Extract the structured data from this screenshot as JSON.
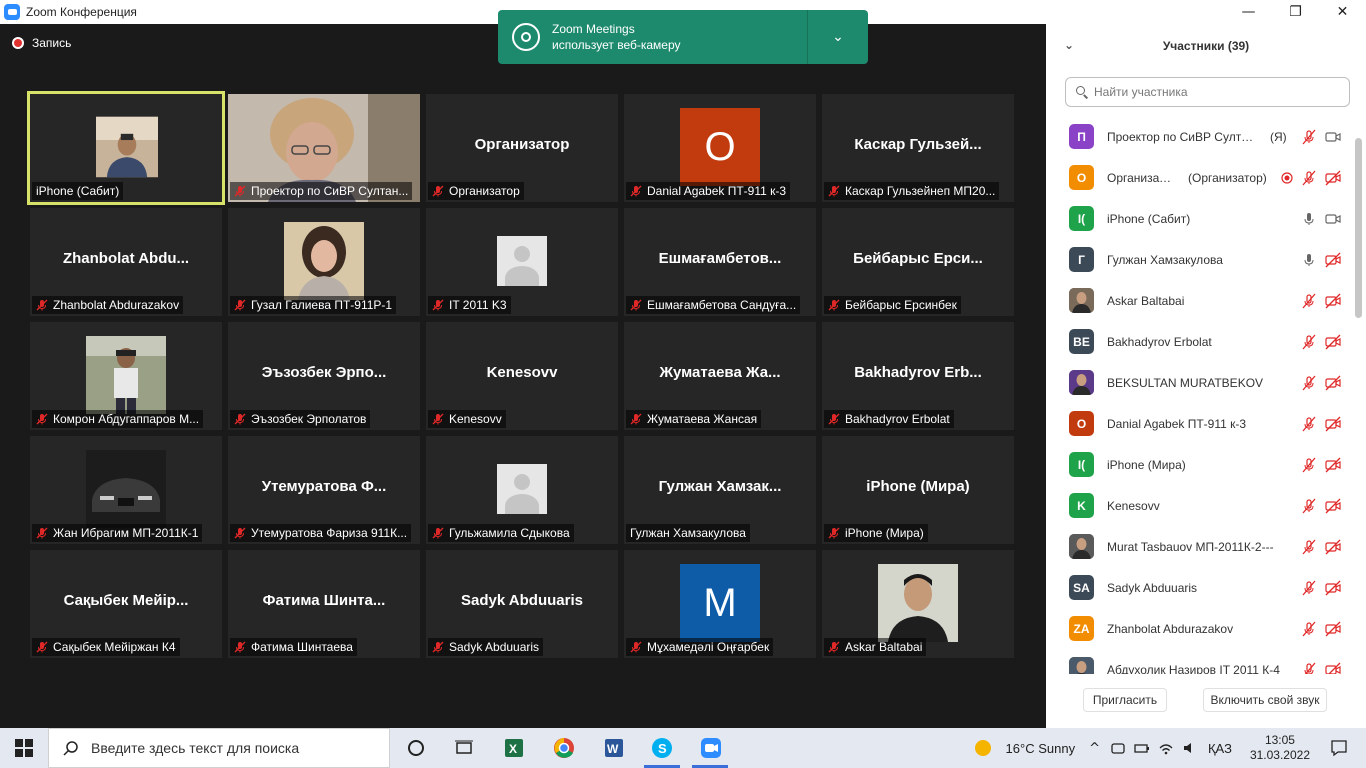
{
  "window": {
    "title": "Zoom Конференция",
    "minimize": "—",
    "restore": "❐",
    "close": "✕"
  },
  "recording": {
    "label": "Запись"
  },
  "notification": {
    "line1": "Zoom Meetings",
    "line2": "использует веб-камеру"
  },
  "tiles": [
    {
      "big": "",
      "label": "iPhone (Сабит)",
      "muted": false,
      "kind": "photo",
      "photo": "man-office"
    },
    {
      "big": "",
      "label": "Проектор по СиВР Султан...",
      "muted": true,
      "kind": "photo",
      "photo": "woman-glasses"
    },
    {
      "big": "Организатор",
      "label": "Организатор",
      "muted": true,
      "kind": "text"
    },
    {
      "big": "",
      "label": "Danial Agabek ПТ-911 к-3",
      "muted": true,
      "kind": "avatar",
      "letter": "O",
      "color": "#c23b0f"
    },
    {
      "big": "Каскар  Гульзей...",
      "label": "Каскар Гульзейнеп МП20...",
      "muted": true,
      "kind": "text"
    },
    {
      "big": "Zhanbolat  Abdu...",
      "label": "Zhanbolat Abdurazakov",
      "muted": true,
      "kind": "text"
    },
    {
      "big": "",
      "label": "Гузал Галиева ПТ-911Р-1",
      "muted": true,
      "kind": "photo",
      "photo": "girl"
    },
    {
      "big": "",
      "label": "IT 2011 K3",
      "muted": true,
      "kind": "placeholder"
    },
    {
      "big": "Ешмағамбетов...",
      "label": "Ешмағамбетова Сандуға...",
      "muted": true,
      "kind": "text"
    },
    {
      "big": "Бейбарыс  Ерси...",
      "label": "Бейбарыс Ерсинбек",
      "muted": true,
      "kind": "text"
    },
    {
      "big": "",
      "label": "Комрон Абдугаппаров М...",
      "muted": true,
      "kind": "photo",
      "photo": "boy-street"
    },
    {
      "big": "Эъзозбек  Эрпо...",
      "label": "Эъзозбек Эрполатов",
      "muted": true,
      "kind": "text"
    },
    {
      "big": "Kenesovv",
      "label": "Kenesovv",
      "muted": true,
      "kind": "text"
    },
    {
      "big": "Жуматаева  Жа...",
      "label": "Жуматаева Жансая",
      "muted": true,
      "kind": "text"
    },
    {
      "big": "Bakhadyrov  Erb...",
      "label": "Bakhadyrov Erbolat",
      "muted": true,
      "kind": "text"
    },
    {
      "big": "",
      "label": "Жан Ибрагим МП-2011К-1",
      "muted": true,
      "kind": "photo",
      "photo": "car"
    },
    {
      "big": "Утемуратова  Ф...",
      "label": "Утемуратова Фариза 911К...",
      "muted": true,
      "kind": "text"
    },
    {
      "big": "",
      "label": "Гульжамила Сдыкова",
      "muted": true,
      "kind": "placeholder"
    },
    {
      "big": "Гулжан  Хамзак...",
      "label": "Гулжан Хамзакулова",
      "muted": false,
      "kind": "text"
    },
    {
      "big": "iPhone (Мира)",
      "label": "iPhone (Мира)",
      "muted": true,
      "kind": "text"
    },
    {
      "big": "Сақыбек  Мейір...",
      "label": "Сақыбек Мейіржан К4",
      "muted": true,
      "kind": "text"
    },
    {
      "big": "Фатима  Шинта...",
      "label": "Фатима Шинтаева",
      "muted": true,
      "kind": "text"
    },
    {
      "big": "Sadyk Abduuaris",
      "label": "Sadyk Abduuaris",
      "muted": true,
      "kind": "text"
    },
    {
      "big": "",
      "label": "Мұхамедәлі Оңғарбек",
      "muted": true,
      "kind": "avatar",
      "letter": "M",
      "color": "#0e5ca8"
    },
    {
      "big": "",
      "label": "Askar Baltabai",
      "muted": true,
      "kind": "photo",
      "photo": "man-young"
    }
  ],
  "panel": {
    "title": "Участники (39)",
    "collapse": "⌄",
    "search_placeholder": "Найти участника",
    "participants": [
      {
        "avatar": "П",
        "color": "#8a43c6",
        "name": "Проектор по СиВР Султан...",
        "role": "(Я)",
        "mic": "muted",
        "video": "on"
      },
      {
        "avatar": "O",
        "color": "#f28c00",
        "name": "Организат...",
        "role": "(Организатор)",
        "mic": "muted",
        "video": "off",
        "recording": true
      },
      {
        "avatar": "I(",
        "color": "#1fa34a",
        "name": "iPhone (Сабит)",
        "role": "",
        "mic": "on",
        "video": "on"
      },
      {
        "avatar": "Г",
        "color": "#3c4a57",
        "name": "Гулжан Хамзакулова",
        "role": "",
        "mic": "on",
        "video": "off"
      },
      {
        "avatar": "",
        "color": "#7a6a5a",
        "name": "Askar Baltabai",
        "role": "",
        "mic": "muted",
        "video": "off",
        "photo": true
      },
      {
        "avatar": "BE",
        "color": "#3c4a57",
        "name": "Bakhadyrov Erbolat",
        "role": "",
        "mic": "muted",
        "video": "off"
      },
      {
        "avatar": "",
        "color": "#5b3a8a",
        "name": "BEKSULTAN MURATBEKOV",
        "role": "",
        "mic": "muted",
        "video": "off",
        "photo": true
      },
      {
        "avatar": "O",
        "color": "#c23b0f",
        "name": "Danial Agabek ПТ-911 к-3",
        "role": "",
        "mic": "muted",
        "video": "off"
      },
      {
        "avatar": "I(",
        "color": "#1fa34a",
        "name": "iPhone (Мира)",
        "role": "",
        "mic": "muted",
        "video": "off"
      },
      {
        "avatar": "K",
        "color": "#1fa34a",
        "name": "Kenesovv",
        "role": "",
        "mic": "muted",
        "video": "off"
      },
      {
        "avatar": "",
        "color": "#5a5a5a",
        "name": "Murat Tasbauov МП-2011К-2---",
        "role": "",
        "mic": "muted",
        "video": "off",
        "photo": true
      },
      {
        "avatar": "SA",
        "color": "#3c4a57",
        "name": "Sadyk Abduuaris",
        "role": "",
        "mic": "muted",
        "video": "off"
      },
      {
        "avatar": "ZA",
        "color": "#f28c00",
        "name": "Zhanbolat Abdurazakov",
        "role": "",
        "mic": "muted",
        "video": "off"
      },
      {
        "avatar": "",
        "color": "#4a5a6a",
        "name": "Абдухолиқ Назиров IT 2011 К-4",
        "role": "",
        "mic": "muted",
        "video": "off",
        "photo": true
      }
    ],
    "invite_label": "Пригласить",
    "unmute_label": "Включить свой звук"
  },
  "taskbar": {
    "search_text": "Введите здесь текст для поиска",
    "weather": "16°C  Sunny",
    "lang": "ҚАЗ",
    "time": "13:05",
    "date": "31.03.2022"
  },
  "colors": {
    "active_speaker": "#d6e368",
    "notification_bg": "#1d8a6e",
    "muted_red": "#e02828"
  }
}
